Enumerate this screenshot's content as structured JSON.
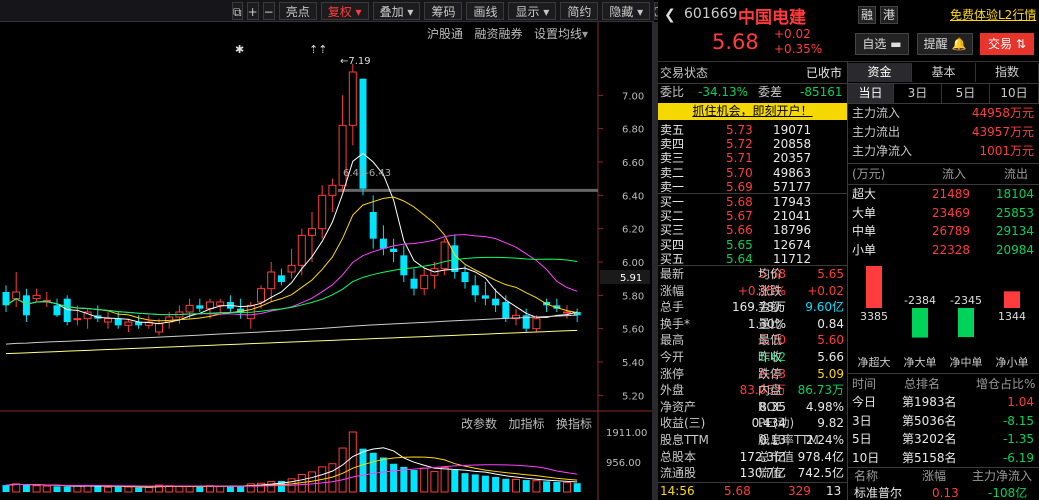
{
  "toolbar": {
    "items": [
      "亮点",
      "复权",
      "叠加",
      "筹码",
      "画线",
      "显示",
      "简约",
      "隐藏"
    ],
    "selected": "复权"
  },
  "chart_overlay": {
    "links": [
      "沪股通",
      "融资融券",
      "设置均线"
    ],
    "indicator_links": [
      "改参数",
      "加指标",
      "换指标"
    ],
    "high_label": "7.19",
    "mid_label": "6.43-6.43",
    "star_marks": "✱",
    "arrow_marks": "⇡⇡"
  },
  "chart_data": {
    "type": "candlestick",
    "y_ticks": [
      "7.00",
      "6.80",
      "6.60",
      "6.40",
      "6.20",
      "6.00",
      "5.80",
      "5.60",
      "5.40",
      "5.20"
    ],
    "current_price": "5.91",
    "volume_ticks": [
      "1911.00",
      "956.00"
    ],
    "candles": [
      [
        5.82,
        5.86,
        5.7,
        5.74
      ],
      [
        5.78,
        5.94,
        5.73,
        5.82
      ],
      [
        5.8,
        5.84,
        5.64,
        5.68
      ],
      [
        5.78,
        5.84,
        5.76,
        5.8
      ],
      [
        5.77,
        5.82,
        5.73,
        5.77
      ],
      [
        5.74,
        5.78,
        5.67,
        5.68
      ],
      [
        5.78,
        5.8,
        5.62,
        5.64
      ],
      [
        5.66,
        5.74,
        5.62,
        5.66
      ],
      [
        5.66,
        5.72,
        5.6,
        5.7
      ],
      [
        5.68,
        5.74,
        5.64,
        5.66
      ],
      [
        5.64,
        5.7,
        5.6,
        5.66
      ],
      [
        5.66,
        5.7,
        5.6,
        5.62
      ],
      [
        5.62,
        5.66,
        5.58,
        5.64
      ],
      [
        5.64,
        5.68,
        5.6,
        5.62
      ],
      [
        5.62,
        5.68,
        5.6,
        5.64
      ],
      [
        5.58,
        5.66,
        5.56,
        5.63
      ],
      [
        5.64,
        5.7,
        5.6,
        5.67
      ],
      [
        5.67,
        5.74,
        5.63,
        5.7
      ],
      [
        5.7,
        5.78,
        5.66,
        5.74
      ],
      [
        5.74,
        5.78,
        5.7,
        5.72
      ],
      [
        5.72,
        5.78,
        5.66,
        5.76
      ],
      [
        5.74,
        5.78,
        5.68,
        5.76
      ],
      [
        5.76,
        5.8,
        5.7,
        5.72
      ],
      [
        5.72,
        5.78,
        5.66,
        5.7
      ],
      [
        5.66,
        5.76,
        5.6,
        5.74
      ],
      [
        5.76,
        5.86,
        5.72,
        5.84
      ],
      [
        5.84,
        6.0,
        5.76,
        5.94
      ],
      [
        5.92,
        5.96,
        5.86,
        5.88
      ],
      [
        5.94,
        6.08,
        5.9,
        5.98
      ],
      [
        5.98,
        6.2,
        5.92,
        6.16
      ],
      [
        6.16,
        6.3,
        6.0,
        6.2
      ],
      [
        6.2,
        6.46,
        6.14,
        6.4
      ],
      [
        6.4,
        6.5,
        6.3,
        6.46
      ],
      [
        6.46,
        7.0,
        6.42,
        6.82
      ],
      [
        6.82,
        7.19,
        6.7,
        7.14
      ],
      [
        7.1,
        7.1,
        6.4,
        6.44
      ],
      [
        6.3,
        6.4,
        6.08,
        6.14
      ],
      [
        6.14,
        6.22,
        6.04,
        6.08
      ],
      [
        6.08,
        6.14,
        6.0,
        6.06
      ],
      [
        6.04,
        6.1,
        5.88,
        5.92
      ],
      [
        5.9,
        5.96,
        5.8,
        5.84
      ],
      [
        5.84,
        5.96,
        5.8,
        5.92
      ],
      [
        5.92,
        6.0,
        5.84,
        5.96
      ],
      [
        5.96,
        6.14,
        5.92,
        6.12
      ],
      [
        6.1,
        6.16,
        5.9,
        5.94
      ],
      [
        5.94,
        5.98,
        5.84,
        5.88
      ],
      [
        5.86,
        5.92,
        5.76,
        5.8
      ],
      [
        5.8,
        5.88,
        5.74,
        5.78
      ],
      [
        5.78,
        5.84,
        5.7,
        5.74
      ],
      [
        5.76,
        5.8,
        5.64,
        5.66
      ],
      [
        5.66,
        5.72,
        5.62,
        5.68
      ],
      [
        5.68,
        5.72,
        5.58,
        5.6
      ],
      [
        5.6,
        5.68,
        5.58,
        5.66
      ],
      [
        5.76,
        5.78,
        5.7,
        5.74
      ],
      [
        5.74,
        5.78,
        5.7,
        5.72
      ],
      [
        5.7,
        5.74,
        5.66,
        5.7
      ],
      [
        5.7,
        5.72,
        5.64,
        5.68
      ]
    ],
    "volumes": [
      220,
      260,
      240,
      200,
      190,
      180,
      170,
      200,
      210,
      190,
      150,
      170,
      160,
      140,
      150,
      220,
      200,
      180,
      190,
      170,
      200,
      180,
      190,
      200,
      260,
      280,
      330,
      350,
      420,
      560,
      640,
      800,
      900,
      1400,
      1911,
      1380,
      1250,
      1100,
      900,
      800,
      700,
      760,
      650,
      780,
      700,
      600,
      560,
      520,
      480,
      420,
      400,
      380,
      360,
      340,
      320,
      300,
      280
    ]
  },
  "stock": {
    "code": "601669",
    "name": "中国电建",
    "price": "5.68",
    "change": "+0.02",
    "pct": "+0.35%",
    "tags": [
      "融",
      "港"
    ],
    "promo": "免费体验L2行情"
  },
  "actions": {
    "watch": "自选",
    "alert": "提醒",
    "trade": "交易"
  },
  "status": {
    "label": "交易状态",
    "value": "已收市"
  },
  "bidask": {
    "weibi_label": "委比",
    "weibi": "-34.13%",
    "weicha_label": "委差",
    "weicha": "-85161",
    "banner": "抓住机会，即刻开户！",
    "sells": [
      [
        "卖五",
        "5.73",
        "19071"
      ],
      [
        "卖四",
        "5.72",
        "20858"
      ],
      [
        "卖三",
        "5.71",
        "20357"
      ],
      [
        "卖二",
        "5.70",
        "49863"
      ],
      [
        "卖一",
        "5.69",
        "57177"
      ]
    ],
    "buys": [
      [
        "买一",
        "5.68",
        "17943"
      ],
      [
        "买二",
        "5.67",
        "21041"
      ],
      [
        "买三",
        "5.66",
        "18796"
      ],
      [
        "买四",
        "5.65",
        "12674"
      ],
      [
        "买五",
        "5.64",
        "11712"
      ]
    ]
  },
  "quote": [
    [
      "最新",
      "5.68",
      "均价",
      "5.65"
    ],
    [
      "涨幅",
      "+0.35%",
      "涨跌",
      "+0.02"
    ],
    [
      "总手",
      "169.78万",
      "金额",
      "9.60亿"
    ],
    [
      "换手*",
      "1.30%",
      "量比",
      "0.84"
    ],
    [
      "最高",
      "5.70",
      "最低",
      "5.60"
    ],
    [
      "今开",
      "5.62",
      "昨收",
      "5.66"
    ],
    [
      "涨停",
      "6.23",
      "跌停",
      "5.09"
    ],
    [
      "外盘",
      "83.05万",
      "内盘",
      "86.73万"
    ],
    [
      "净资产",
      "8.35",
      "ROE",
      "4.98%"
    ],
    [
      "收益(三)",
      "0.434",
      "PE(动)",
      "9.82"
    ],
    [
      "股息TTM",
      "0.13",
      "股息率TTM",
      "2.24%"
    ],
    [
      "总股本",
      "172.3亿",
      "总市值",
      "978.4亿"
    ],
    [
      "流通股",
      "130.7亿",
      "流值",
      "742.5亿"
    ]
  ],
  "tick": {
    "time": "14:56",
    "price": "5.68",
    "vol": "329",
    "n": "13"
  },
  "fund": {
    "tabs": [
      "资金",
      "基本",
      "指数"
    ],
    "periods": [
      "当日",
      "3日",
      "5日",
      "10日"
    ],
    "rows": [
      [
        "主力流入",
        "44958万元"
      ],
      [
        "主力流出",
        "43957万元"
      ],
      [
        "主力净流入",
        "1001万元"
      ]
    ],
    "table_header": [
      "(万元)",
      "流入",
      "流出"
    ],
    "table": [
      [
        "超大",
        "21489",
        "18104"
      ],
      [
        "大单",
        "23469",
        "25853"
      ],
      [
        "中单",
        "26789",
        "29134"
      ],
      [
        "小单",
        "22328",
        "20984"
      ]
    ],
    "bars": [
      3385,
      -2384,
      -2345,
      1344
    ],
    "bar_labels": [
      "3385",
      "-2384",
      "-2345",
      "1344"
    ],
    "bar_names": [
      "净超大",
      "净大单",
      "净中单",
      "净小单"
    ]
  },
  "rank": {
    "header": [
      "时间",
      "总排名",
      "增仓占比%"
    ],
    "rows": [
      [
        "今日",
        "第1983名",
        "1.04"
      ],
      [
        "3日",
        "第5036名",
        "-8.15"
      ],
      [
        "5日",
        "第3202名",
        "-1.35"
      ],
      [
        "10日",
        "第5158名",
        "-6.19"
      ]
    ]
  },
  "bottom": {
    "header": [
      "名称",
      "涨幅",
      "主力净流入"
    ],
    "row": [
      "标准普尔",
      "0.13",
      "-108亿"
    ]
  },
  "colors": {
    "up": "#ff3b3b",
    "down": "#00e5ff",
    "bg": "#000000"
  }
}
